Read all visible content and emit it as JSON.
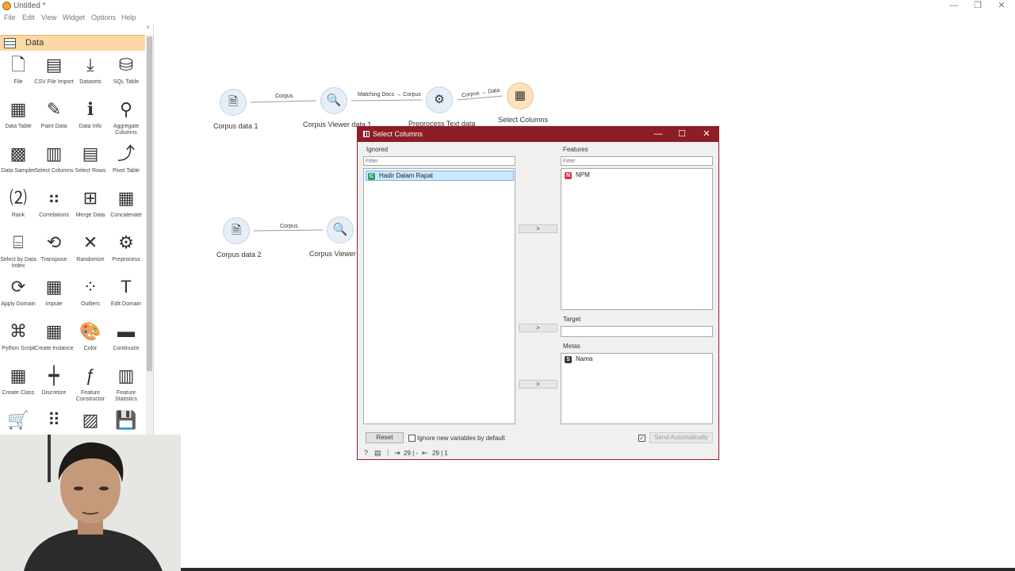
{
  "window": {
    "title": "Untitled *",
    "minimize": "—",
    "maximize": "❐",
    "close": "✕"
  },
  "menu": [
    "File",
    "Edit",
    "View",
    "Widget",
    "Options",
    "Help"
  ],
  "sidebar": {
    "category": "Data",
    "close_glyph": "×",
    "tools": [
      {
        "label": "File",
        "icon": "🗋",
        "icon_name": "file-icon"
      },
      {
        "label": "CSV File Import",
        "icon": "▤",
        "icon_name": "csv-file-icon"
      },
      {
        "label": "Datasets",
        "icon": "⤓",
        "icon_name": "datasets-icon"
      },
      {
        "label": "SQL Table",
        "icon": "⛁",
        "icon_name": "database-icon"
      },
      {
        "label": "Data Table",
        "icon": "▦",
        "icon_name": "data-table-icon"
      },
      {
        "label": "Paint Data",
        "icon": "✎",
        "icon_name": "paint-data-icon"
      },
      {
        "label": "Data Info",
        "icon": "ℹ",
        "icon_name": "data-info-icon"
      },
      {
        "label": "Aggregate Columns",
        "icon": "⚲",
        "icon_name": "aggregate-icon"
      },
      {
        "label": "Data Sampler",
        "icon": "▩",
        "icon_name": "data-sampler-icon"
      },
      {
        "label": "Select Columns",
        "icon": "▥",
        "icon_name": "select-columns-icon"
      },
      {
        "label": "Select Rows",
        "icon": "▤",
        "icon_name": "select-rows-icon"
      },
      {
        "label": "Pivot Table",
        "icon": "⤴",
        "icon_name": "pivot-table-icon"
      },
      {
        "label": "Rank",
        "icon": "⑵",
        "icon_name": "rank-icon"
      },
      {
        "label": "Correlations",
        "icon": "⠶",
        "icon_name": "correlations-icon"
      },
      {
        "label": "Merge Data",
        "icon": "⊞",
        "icon_name": "merge-data-icon"
      },
      {
        "label": "Concatenate",
        "icon": "▦",
        "icon_name": "concatenate-icon"
      },
      {
        "label": "Select by Data Index",
        "icon": "⌸",
        "icon_name": "select-by-index-icon"
      },
      {
        "label": "Transpose",
        "icon": "⟲",
        "icon_name": "transpose-icon"
      },
      {
        "label": "Randomize",
        "icon": "✕",
        "icon_name": "randomize-icon"
      },
      {
        "label": "Preprocess",
        "icon": "⚙",
        "icon_name": "preprocess-icon"
      },
      {
        "label": "Apply Domain",
        "icon": "⟳",
        "icon_name": "apply-domain-icon"
      },
      {
        "label": "Impute",
        "icon": "▦",
        "icon_name": "impute-icon"
      },
      {
        "label": "Outliers",
        "icon": "⁘",
        "icon_name": "outliers-icon"
      },
      {
        "label": "Edit Domain",
        "icon": "T",
        "icon_name": "edit-domain-icon"
      },
      {
        "label": "Python Script",
        "icon": "⌘",
        "icon_name": "python-script-icon"
      },
      {
        "label": "Create Instance",
        "icon": "▦",
        "icon_name": "create-instance-icon"
      },
      {
        "label": "Color",
        "icon": "🎨",
        "icon_name": "color-palette-icon"
      },
      {
        "label": "Continuize",
        "icon": "▬",
        "icon_name": "continuize-icon"
      },
      {
        "label": "Create Class",
        "icon": "▦",
        "icon_name": "create-class-icon"
      },
      {
        "label": "Discretize",
        "icon": "┿",
        "icon_name": "discretize-icon"
      },
      {
        "label": "Feature Constructor",
        "icon": "ƒ",
        "icon_name": "feature-constructor-icon"
      },
      {
        "label": "Feature Statistics",
        "icon": "▥",
        "icon_name": "feature-statistics-icon"
      },
      {
        "label": "",
        "icon": "🛒",
        "icon_name": "cart-icon"
      },
      {
        "label": "",
        "icon": "⠿",
        "icon_name": "dots-grid-icon"
      },
      {
        "label": "",
        "icon": "▨",
        "icon_name": "table-edit-icon"
      },
      {
        "label": "",
        "icon": "💾",
        "icon_name": "save-icon"
      }
    ]
  },
  "canvas": {
    "nodes": {
      "corpus1": {
        "label": "Corpus data 1",
        "icon": "🗎"
      },
      "viewer1": {
        "label": "Corpus Viewer data 1",
        "icon": "🔍"
      },
      "preprocess": {
        "label": "Preprocess Text data",
        "icon": "⚙"
      },
      "select_columns": {
        "label": "Select Columns",
        "icon": "▦"
      },
      "corpus2": {
        "label": "Corpus data 2",
        "icon": "🗎"
      },
      "viewer2": {
        "label": "Corpus Viewer d",
        "icon": "🔍"
      }
    },
    "links": {
      "l1": "Corpus",
      "l2": "Matching Docs → Corpus",
      "l3": "Corpus → Data",
      "l4": "Corpus"
    }
  },
  "dialog": {
    "title": "Select Columns",
    "minimize": "—",
    "maximize": "☐",
    "close": "✕",
    "ignored": {
      "label": "Ignored",
      "filter_placeholder": "Filter",
      "items": [
        {
          "badge": "C",
          "name": "Hadir Dalam Rapat",
          "color": "#2e9e6f"
        }
      ]
    },
    "features": {
      "label": "Features",
      "filter_placeholder": "Filter",
      "items": [
        {
          "badge": "N",
          "name": "NPM",
          "color": "#d9364a"
        }
      ]
    },
    "target": {
      "label": "Target"
    },
    "metas": {
      "label": "Metas",
      "items": [
        {
          "badge": "S",
          "name": "Nama",
          "color": "#333333"
        }
      ]
    },
    "move_button": ">",
    "reset_label": "Reset",
    "ignore_new_label": "Ignore new variables by default",
    "ignore_new_checked": false,
    "send_auto_checked": true,
    "send_auto_label": "Send Automatically",
    "status_in": "29 | -",
    "status_out": "29 | 1"
  }
}
